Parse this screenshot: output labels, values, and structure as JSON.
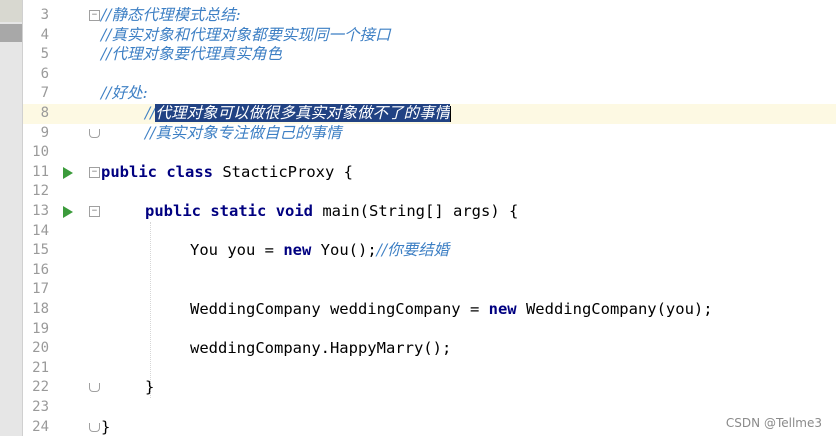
{
  "editor": {
    "lines": [
      {
        "n": "3",
        "text": "//静态代理模式总结:"
      },
      {
        "n": "4",
        "text": "//真实对象和代理对象都要实现同一个接口"
      },
      {
        "n": "5",
        "text": "//代理对象要代理真实角色"
      },
      {
        "n": "6",
        "text": ""
      },
      {
        "n": "7",
        "text": "//好处:"
      },
      {
        "n": "8",
        "pre": "//",
        "selected": "代理对象可以做很多真实对象做不了的事情"
      },
      {
        "n": "9",
        "text": "//真实对象专注做自己的事情"
      },
      {
        "n": "10",
        "text": ""
      },
      {
        "n": "11",
        "kw1": "public",
        "kw2": "class",
        "rest": " StacticProxy {"
      },
      {
        "n": "12",
        "text": ""
      },
      {
        "n": "13",
        "kw1": "public",
        "kw2": "static",
        "kw3": "void",
        "rest": " main(String[] args) {"
      },
      {
        "n": "14",
        "text": ""
      },
      {
        "n": "15",
        "a": "You you = ",
        "kw": "new",
        "b": " You();",
        "cmt": "//你要结婚"
      },
      {
        "n": "16",
        "text": ""
      },
      {
        "n": "17",
        "text": ""
      },
      {
        "n": "18",
        "a": "WeddingCompany weddingCompany = ",
        "kw": "new",
        "b": " WeddingCompany(you);"
      },
      {
        "n": "19",
        "text": ""
      },
      {
        "n": "20",
        "text": "weddingCompany.HappyMarry();"
      },
      {
        "n": "21",
        "text": ""
      },
      {
        "n": "22",
        "text": "}"
      },
      {
        "n": "23",
        "text": ""
      },
      {
        "n": "24",
        "text": "}"
      }
    ]
  },
  "watermark": "CSDN @Tellme3"
}
